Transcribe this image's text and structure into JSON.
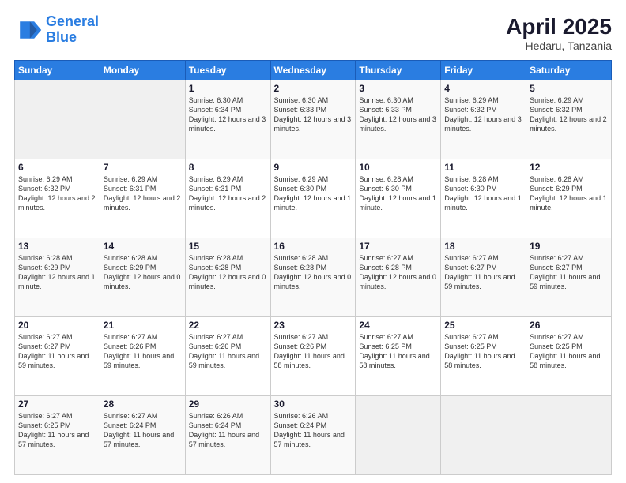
{
  "header": {
    "logo_line1": "General",
    "logo_line2": "Blue",
    "title": "April 2025",
    "subtitle": "Hedaru, Tanzania"
  },
  "columns": [
    "Sunday",
    "Monday",
    "Tuesday",
    "Wednesday",
    "Thursday",
    "Friday",
    "Saturday"
  ],
  "weeks": [
    [
      {
        "day": "",
        "detail": ""
      },
      {
        "day": "",
        "detail": ""
      },
      {
        "day": "1",
        "detail": "Sunrise: 6:30 AM\nSunset: 6:34 PM\nDaylight: 12 hours and 3 minutes."
      },
      {
        "day": "2",
        "detail": "Sunrise: 6:30 AM\nSunset: 6:33 PM\nDaylight: 12 hours and 3 minutes."
      },
      {
        "day": "3",
        "detail": "Sunrise: 6:30 AM\nSunset: 6:33 PM\nDaylight: 12 hours and 3 minutes."
      },
      {
        "day": "4",
        "detail": "Sunrise: 6:29 AM\nSunset: 6:32 PM\nDaylight: 12 hours and 3 minutes."
      },
      {
        "day": "5",
        "detail": "Sunrise: 6:29 AM\nSunset: 6:32 PM\nDaylight: 12 hours and 2 minutes."
      }
    ],
    [
      {
        "day": "6",
        "detail": "Sunrise: 6:29 AM\nSunset: 6:32 PM\nDaylight: 12 hours and 2 minutes."
      },
      {
        "day": "7",
        "detail": "Sunrise: 6:29 AM\nSunset: 6:31 PM\nDaylight: 12 hours and 2 minutes."
      },
      {
        "day": "8",
        "detail": "Sunrise: 6:29 AM\nSunset: 6:31 PM\nDaylight: 12 hours and 2 minutes."
      },
      {
        "day": "9",
        "detail": "Sunrise: 6:29 AM\nSunset: 6:30 PM\nDaylight: 12 hours and 1 minute."
      },
      {
        "day": "10",
        "detail": "Sunrise: 6:28 AM\nSunset: 6:30 PM\nDaylight: 12 hours and 1 minute."
      },
      {
        "day": "11",
        "detail": "Sunrise: 6:28 AM\nSunset: 6:30 PM\nDaylight: 12 hours and 1 minute."
      },
      {
        "day": "12",
        "detail": "Sunrise: 6:28 AM\nSunset: 6:29 PM\nDaylight: 12 hours and 1 minute."
      }
    ],
    [
      {
        "day": "13",
        "detail": "Sunrise: 6:28 AM\nSunset: 6:29 PM\nDaylight: 12 hours and 1 minute."
      },
      {
        "day": "14",
        "detail": "Sunrise: 6:28 AM\nSunset: 6:29 PM\nDaylight: 12 hours and 0 minutes."
      },
      {
        "day": "15",
        "detail": "Sunrise: 6:28 AM\nSunset: 6:28 PM\nDaylight: 12 hours and 0 minutes."
      },
      {
        "day": "16",
        "detail": "Sunrise: 6:28 AM\nSunset: 6:28 PM\nDaylight: 12 hours and 0 minutes."
      },
      {
        "day": "17",
        "detail": "Sunrise: 6:27 AM\nSunset: 6:28 PM\nDaylight: 12 hours and 0 minutes."
      },
      {
        "day": "18",
        "detail": "Sunrise: 6:27 AM\nSunset: 6:27 PM\nDaylight: 11 hours and 59 minutes."
      },
      {
        "day": "19",
        "detail": "Sunrise: 6:27 AM\nSunset: 6:27 PM\nDaylight: 11 hours and 59 minutes."
      }
    ],
    [
      {
        "day": "20",
        "detail": "Sunrise: 6:27 AM\nSunset: 6:27 PM\nDaylight: 11 hours and 59 minutes."
      },
      {
        "day": "21",
        "detail": "Sunrise: 6:27 AM\nSunset: 6:26 PM\nDaylight: 11 hours and 59 minutes."
      },
      {
        "day": "22",
        "detail": "Sunrise: 6:27 AM\nSunset: 6:26 PM\nDaylight: 11 hours and 59 minutes."
      },
      {
        "day": "23",
        "detail": "Sunrise: 6:27 AM\nSunset: 6:26 PM\nDaylight: 11 hours and 58 minutes."
      },
      {
        "day": "24",
        "detail": "Sunrise: 6:27 AM\nSunset: 6:25 PM\nDaylight: 11 hours and 58 minutes."
      },
      {
        "day": "25",
        "detail": "Sunrise: 6:27 AM\nSunset: 6:25 PM\nDaylight: 11 hours and 58 minutes."
      },
      {
        "day": "26",
        "detail": "Sunrise: 6:27 AM\nSunset: 6:25 PM\nDaylight: 11 hours and 58 minutes."
      }
    ],
    [
      {
        "day": "27",
        "detail": "Sunrise: 6:27 AM\nSunset: 6:25 PM\nDaylight: 11 hours and 57 minutes."
      },
      {
        "day": "28",
        "detail": "Sunrise: 6:27 AM\nSunset: 6:24 PM\nDaylight: 11 hours and 57 minutes."
      },
      {
        "day": "29",
        "detail": "Sunrise: 6:26 AM\nSunset: 6:24 PM\nDaylight: 11 hours and 57 minutes."
      },
      {
        "day": "30",
        "detail": "Sunrise: 6:26 AM\nSunset: 6:24 PM\nDaylight: 11 hours and 57 minutes."
      },
      {
        "day": "",
        "detail": ""
      },
      {
        "day": "",
        "detail": ""
      },
      {
        "day": "",
        "detail": ""
      }
    ]
  ]
}
